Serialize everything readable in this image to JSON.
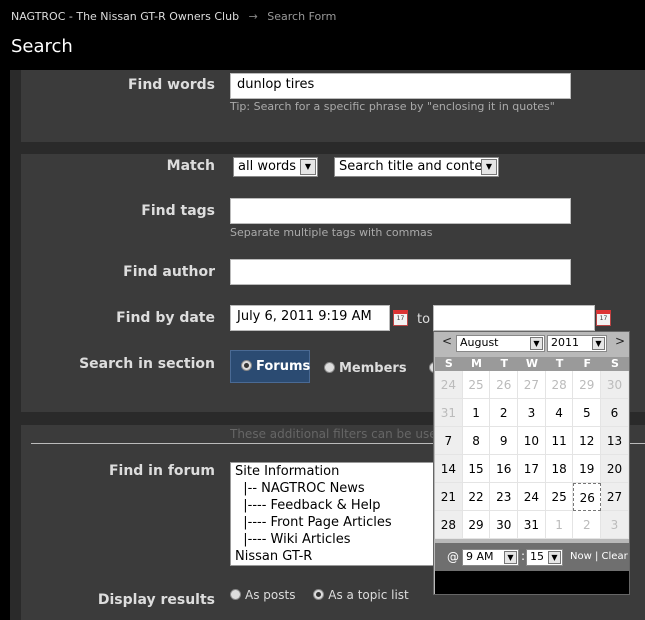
{
  "breadcrumb": {
    "home": "NAGTROC - The Nissan GT-R Owners Club",
    "arrow": "→",
    "current": "Search Form"
  },
  "page_title": "Search",
  "find_words": {
    "label": "Find words",
    "value": "dunlop tires",
    "tip": "Tip: Search for a specific phrase by \"enclosing it in quotes\""
  },
  "match": {
    "label": "Match",
    "mode": "all words",
    "scope": "Search title and content"
  },
  "find_tags": {
    "label": "Find tags",
    "value": "",
    "tip": "Separate multiple tags with commas"
  },
  "find_author": {
    "label": "Find author",
    "value": ""
  },
  "find_by_date": {
    "label": "Find by date",
    "from": "July 6, 2011 9:19 AM",
    "to_label": "to",
    "to": ""
  },
  "search_in_section": {
    "label": "Search in section",
    "forums": "Forums",
    "members": "Members"
  },
  "filters_note": "These additional filters can be used t",
  "find_in_forum": {
    "label": "Find in forum",
    "items": [
      "Site Information",
      "  |-- NAGTROC News",
      "  |---- Feedback & Help",
      "  |---- Front Page Articles",
      "  |---- Wiki Articles",
      "Nissan GT-R"
    ]
  },
  "display_results": {
    "label": "Display results",
    "as_posts": "As posts",
    "as_topics": "As a topic list"
  },
  "calendar": {
    "prev": "<",
    "next": ">",
    "month": "August",
    "year": "2011",
    "weekdays": [
      "S",
      "M",
      "T",
      "W",
      "T",
      "F",
      "S"
    ],
    "weeks": [
      [
        "24",
        "25",
        "26",
        "27",
        "28",
        "29",
        "30"
      ],
      [
        "31",
        "1",
        "2",
        "3",
        "4",
        "5",
        "6"
      ],
      [
        "7",
        "8",
        "9",
        "10",
        "11",
        "12",
        "13"
      ],
      [
        "14",
        "15",
        "16",
        "17",
        "18",
        "19",
        "20"
      ],
      [
        "21",
        "22",
        "23",
        "24",
        "25",
        "26",
        "27"
      ],
      [
        "28",
        "29",
        "30",
        "31",
        "1",
        "2",
        "3"
      ]
    ],
    "at": "@",
    "hour": "9 AM",
    "colon": ":",
    "minute": "15",
    "now": "Now",
    "separator": "|",
    "clear": "Clear",
    "today": "26"
  }
}
